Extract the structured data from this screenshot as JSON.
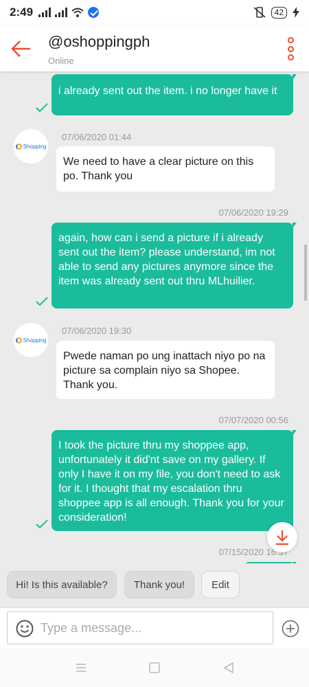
{
  "status_bar": {
    "time": "2:49",
    "battery": "42"
  },
  "header": {
    "title": "@oshoppingph",
    "status": "Online"
  },
  "avatar_label": "Shopping",
  "messages": [
    {
      "from": "me",
      "text": "i already sent out the item. i no longer have it"
    },
    {
      "from": "shop",
      "timestamp": "07/06/2020 01:44",
      "text": "We need to have a clear picture on this po. Thank you"
    },
    {
      "from": "me",
      "timestamp": "07/06/2020 19:29",
      "text": "again, how can i send a picture if i already sent out the item? please understand, im not able to send any pictures anymore since the item was already sent out thru MLhuilier."
    },
    {
      "from": "shop",
      "timestamp": "07/06/2020 19:30",
      "text": "Pwede naman po ung inattach niyo po na picture sa complain niyo sa Shopee. Thank you."
    },
    {
      "from": "me",
      "timestamp": "07/07/2020 00:56",
      "text": "I took the picture thru my shoppee app, unfortunately it did'nt save on my gallery. If only I have it on my file, you don't need to ask for it. I thought that my escalation thru shoppee app is all enough. Thank you for your consideration!"
    },
    {
      "from": "me",
      "timestamp": "07/15/2020 16:37",
      "text": ""
    }
  ],
  "quick_replies": [
    "Hi! Is this available?",
    "Thank you!",
    "Edit"
  ],
  "composer": {
    "placeholder": "Type a message..."
  },
  "colors": {
    "accent": "#ee4d2d",
    "outgoing_bubble": "#1abc9c",
    "incoming_bubble": "#ffffff",
    "background": "#ebebeb"
  }
}
